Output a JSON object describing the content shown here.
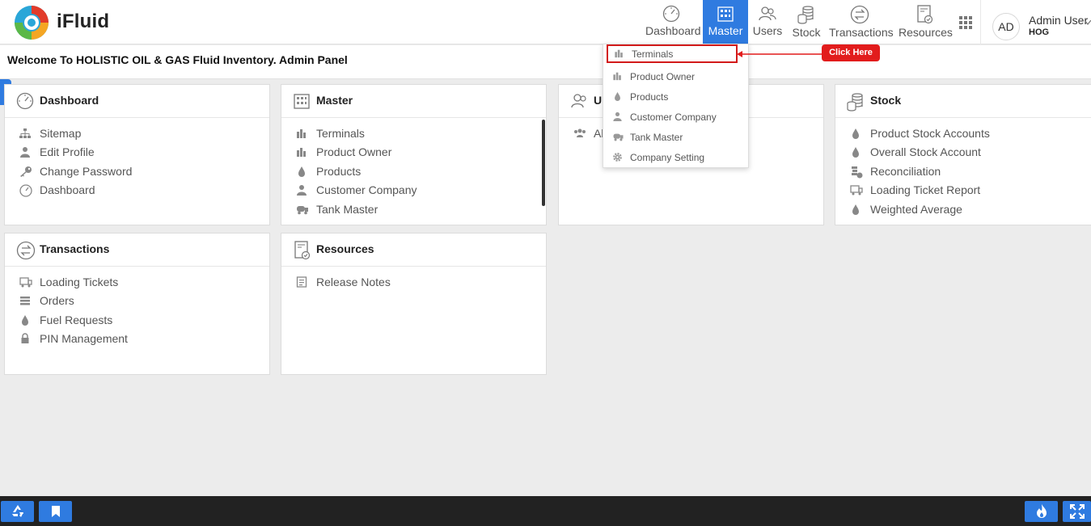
{
  "app": {
    "name": "iFluid"
  },
  "nav": {
    "items": [
      {
        "label": "Dashboard"
      },
      {
        "label": "Master"
      },
      {
        "label": "Users"
      },
      {
        "label": "Stock"
      },
      {
        "label": "Transactions"
      },
      {
        "label": "Resources"
      }
    ],
    "active": "Master"
  },
  "user": {
    "initials": "AD",
    "name": "Admin User",
    "org": "HOG"
  },
  "welcome": "Welcome To HOLISTIC OIL & GAS Fluid Inventory. Admin Panel",
  "dropdown": {
    "items": [
      {
        "label": "Terminals",
        "icon": "terminal-icon"
      },
      {
        "label": "Product Owner",
        "icon": "building-icon"
      },
      {
        "label": "Products",
        "icon": "drop-icon"
      },
      {
        "label": "Customer Company",
        "icon": "user-icon"
      },
      {
        "label": "Tank Master",
        "icon": "tanker-icon"
      },
      {
        "label": "Company Setting",
        "icon": "gear-icon"
      }
    ],
    "highlighted": "Terminals"
  },
  "callout": {
    "text": "Click Here",
    "color": "#e21c1c"
  },
  "cards": {
    "dashboard": {
      "title": "Dashboard",
      "items": [
        "Sitemap",
        "Edit Profile",
        "Change Password",
        "Dashboard"
      ]
    },
    "master": {
      "title": "Master",
      "items": [
        "Terminals",
        "Product Owner",
        "Products",
        "Customer Company",
        "Tank Master"
      ]
    },
    "users": {
      "title": "U",
      "items": [
        "Al"
      ]
    },
    "stock": {
      "title": "Stock",
      "items": [
        "Product Stock Accounts",
        "Overall Stock Account",
        "Reconciliation",
        "Loading Ticket Report",
        "Weighted Average"
      ]
    },
    "transactions": {
      "title": "Transactions",
      "items": [
        "Loading Tickets",
        "Orders",
        "Fuel Requests",
        "PIN Management"
      ]
    },
    "resources": {
      "title": "Resources",
      "items": [
        "Release Notes"
      ]
    }
  },
  "colors": {
    "accent": "#2f7be0",
    "highlight": "#d21a1a",
    "bottombar": "#222222"
  }
}
